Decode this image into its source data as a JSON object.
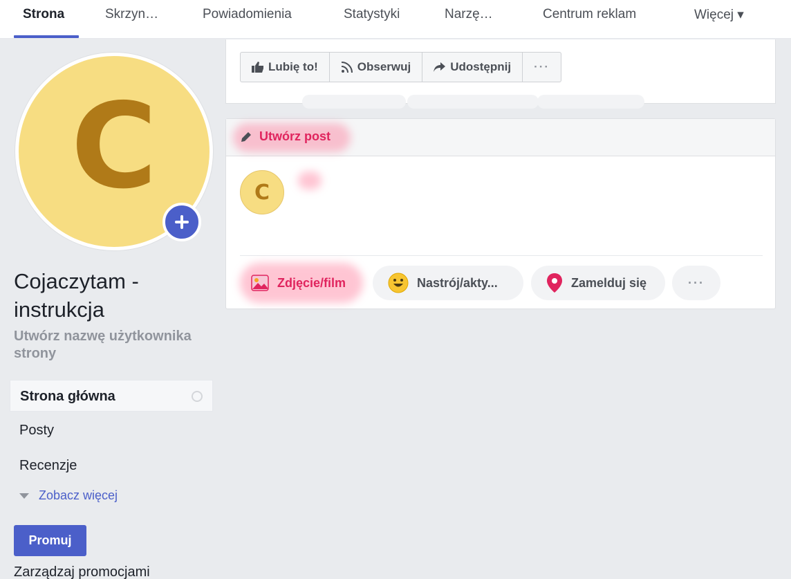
{
  "top_nav": {
    "tabs": [
      {
        "label": "Strona",
        "active": true
      },
      {
        "label": "Skrzyn…",
        "active": false
      },
      {
        "label": "Powiadomienia",
        "active": false
      },
      {
        "label": "Statystyki",
        "active": false
      },
      {
        "label": "Narzę…",
        "active": false
      },
      {
        "label": "Centrum reklam",
        "active": false
      },
      {
        "label": "Więcej ▾",
        "active": false
      }
    ]
  },
  "profile": {
    "avatar_letter": "C",
    "avatar_color": "#f7dd82",
    "avatar_letter_color": "#b07a18",
    "page_name": "Cojaczytam - instrukcja",
    "username_hint": "Utwórz nazwę użytkownika strony"
  },
  "side_nav": {
    "items": [
      {
        "label": "Strona główna",
        "active": true
      },
      {
        "label": "Posty",
        "active": false
      },
      {
        "label": "Recenzje",
        "active": false
      }
    ],
    "see_more": "Zobacz więcej",
    "promote_button": "Promuj",
    "manage_promotions": "Zarządzaj promocjami"
  },
  "action_bar": {
    "like": "Lubię to!",
    "follow": "Obserwuj",
    "share": "Udostępnij",
    "more": "···"
  },
  "create_post": {
    "title": "Utwórz post",
    "avatar_letter": "C",
    "compose_placeholder": "",
    "options": [
      {
        "label": "Zdjęcie/film",
        "icon": "photo-icon"
      },
      {
        "label": "Nastrój/akty...",
        "icon": "smiley-icon"
      },
      {
        "label": "Zamelduj się",
        "icon": "location-pin-icon"
      }
    ],
    "more": "···"
  },
  "colors": {
    "accent": "#4b5fc9",
    "highlight": "#e0245e",
    "background": "#e9ebee"
  }
}
